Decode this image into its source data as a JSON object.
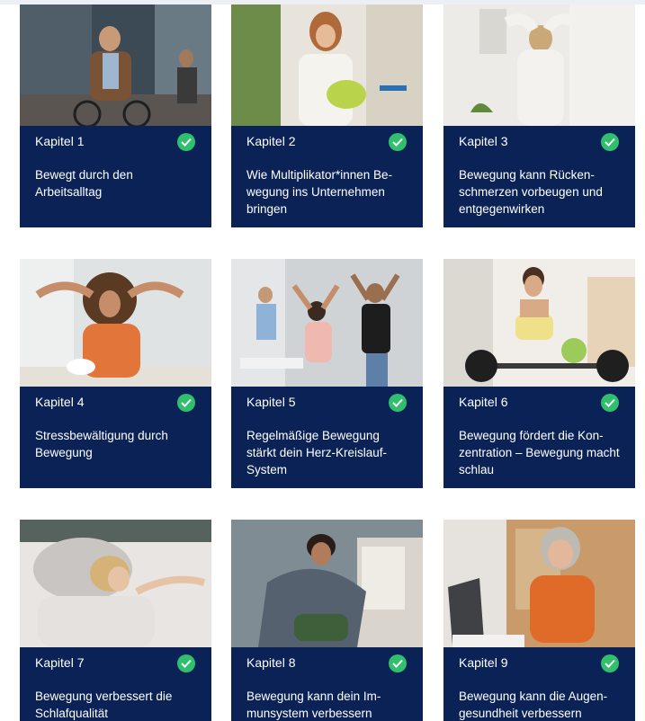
{
  "chapters": [
    {
      "label": "Kapitel 1",
      "title": "Bewegt durch den Arbeitsalltag",
      "completed": true,
      "image": "man-cycling-to-work"
    },
    {
      "label": "Kapitel 2",
      "title": "Wie Multiplikator*innen Be-wegung ins Unternehmen bringen",
      "completed": true,
      "image": "woman-holding-yoga-mat"
    },
    {
      "label": "Kapitel 3",
      "title": "Bewegung kann Rücken-schmerzen vorbeugen und entgegenwirken",
      "completed": true,
      "image": "woman-stretching-back"
    },
    {
      "label": "Kapitel 4",
      "title": "Stressbewältigung durch Bewegung",
      "completed": true,
      "image": "woman-relaxing-at-desk"
    },
    {
      "label": "Kapitel 5",
      "title": "Regelmäßige Bewegung stärkt dein Herz-Kreislauf-System",
      "completed": true,
      "image": "colleagues-stretching-office"
    },
    {
      "label": "Kapitel 6",
      "title": "Bewegung fördert die Kon-zentration – Bewegung macht schlau",
      "completed": true,
      "image": "woman-lifting-barbell"
    },
    {
      "label": "Kapitel 7",
      "title": "Bewegung verbessert die Schlafqualität",
      "completed": true,
      "image": "woman-sleeping"
    },
    {
      "label": "Kapitel 8",
      "title": "Bewegung kann dein Im-munsystem verbessern",
      "completed": true,
      "image": "man-sick-in-blanket"
    },
    {
      "label": "Kapitel 9",
      "title": "Bewegung kann die Augen-gesundheit verbessern",
      "completed": true,
      "image": "woman-at-laptop"
    }
  ],
  "colors": {
    "card_background": "#0b2257",
    "check": "#2fbf6d",
    "text": "#ffffff"
  },
  "icons": {
    "completed": "check-circle-icon"
  }
}
